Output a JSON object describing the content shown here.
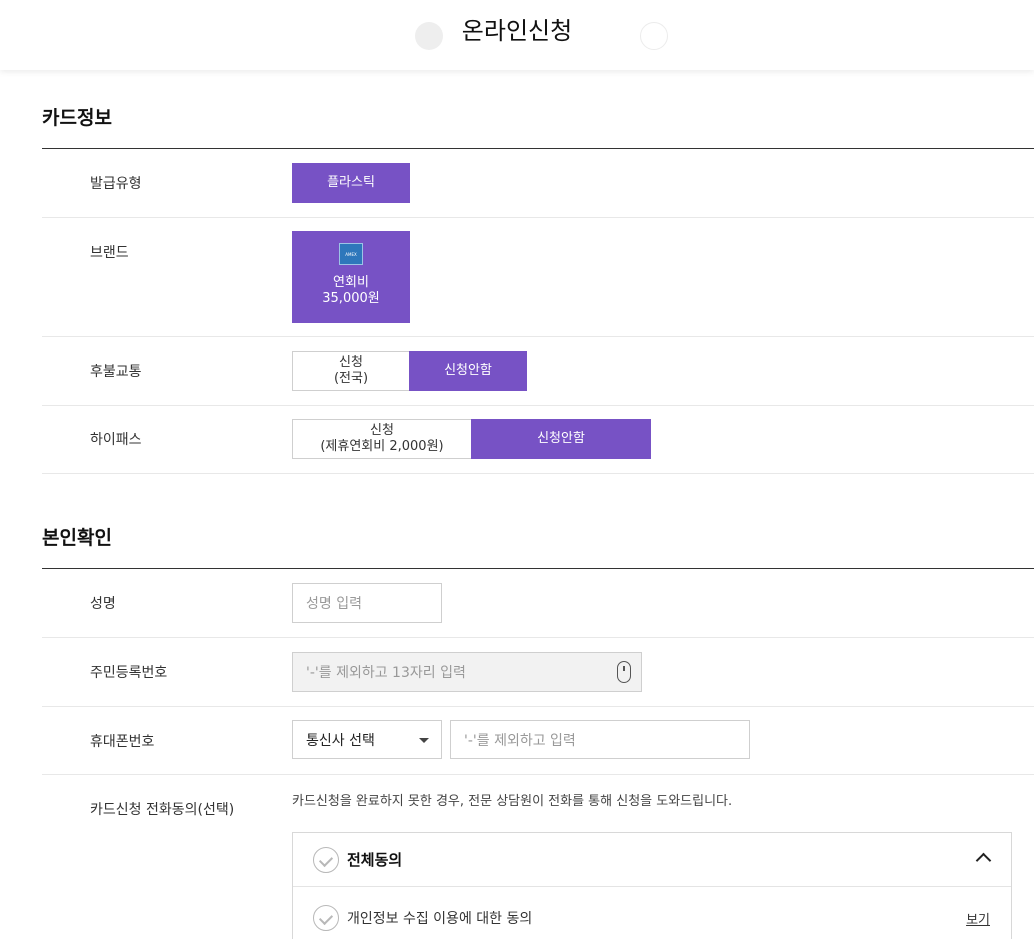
{
  "header": {
    "title": "온라인신청"
  },
  "card_info": {
    "section_title": "카드정보",
    "issue_type": {
      "label": "발급유형",
      "option": "플라스틱"
    },
    "brand": {
      "label": "브랜드",
      "icon": "amex-logo-icon",
      "fee_label": "연회비",
      "fee_value": "35,000원"
    },
    "transit": {
      "label": "후불교통",
      "apply_line1": "신청",
      "apply_line2": "(전국)",
      "decline": "신청안함"
    },
    "hipass": {
      "label": "하이패스",
      "apply_line1": "신청",
      "apply_line2": "(제휴연회비 2,000원)",
      "decline": "신청안함"
    }
  },
  "identity": {
    "section_title": "본인확인",
    "name": {
      "label": "성명",
      "placeholder": "성명 입력"
    },
    "resident_no": {
      "label": "주민등록번호",
      "placeholder": "'-'를 제외하고 13자리 입력"
    },
    "phone": {
      "label": "휴대폰번호",
      "carrier_select": "통신사 선택",
      "placeholder": "'-'를 제외하고 입력"
    },
    "phone_consent": {
      "label": "카드신청 전화동의(선택)",
      "description": "카드신청을 완료하지 못한 경우, 전문 상담원이 전화를 통해 신청을 도와드립니다.",
      "agree_all": "전체동의",
      "items": [
        {
          "label": "개인정보 수집 이용에 대한 동의",
          "link": "보기"
        }
      ]
    }
  },
  "colors": {
    "accent": "#7752c5"
  }
}
